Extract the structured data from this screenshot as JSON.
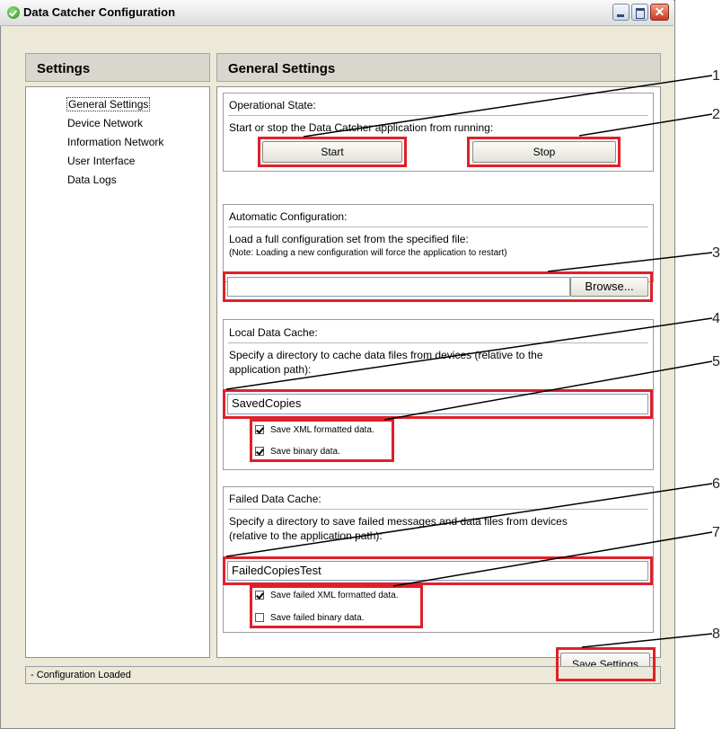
{
  "window": {
    "title": "Data Catcher Configuration"
  },
  "sidebar": {
    "header": "Settings",
    "items": [
      {
        "label": "General Settings",
        "selected": true
      },
      {
        "label": "Device Network"
      },
      {
        "label": "Information Network"
      },
      {
        "label": "User Interface"
      },
      {
        "label": "Data Logs"
      }
    ]
  },
  "main": {
    "header": "General Settings",
    "operational": {
      "title": "Operational State:",
      "desc": "Start or stop the Data Catcher application from running:",
      "start_label": "Start",
      "stop_label": "Stop"
    },
    "auto_config": {
      "title": "Automatic Configuration:",
      "desc": "Load a full configuration set from the specified file:",
      "note": "(Note: Loading a new configuration will force the application to restart)",
      "file_value": "",
      "browse_label": "Browse..."
    },
    "local_cache": {
      "title": "Local Data Cache:",
      "desc_line1": "Specify a directory to cache data files from devices (relative to the",
      "desc_line2": "application path):",
      "dir_value": "SavedCopies",
      "save_xml_label": "Save XML formatted data.",
      "save_xml_checked": true,
      "save_binary_label": "Save binary data.",
      "save_binary_checked": true
    },
    "failed_cache": {
      "title": "Failed Data Cache:",
      "desc_line1": "Specify a directory to save failed messages and data files from devices",
      "desc_line2": "(relative to the application path):",
      "dir_value": "FailedCopiesTest",
      "save_xml_label": "Save failed XML formatted data.",
      "save_xml_checked": true,
      "save_binary_label": "Save failed binary data.",
      "save_binary_checked": false
    },
    "save_settings_label": "Save Settings"
  },
  "status": {
    "text": "- Configuration Loaded"
  },
  "callouts": [
    "1",
    "2",
    "3",
    "4",
    "5",
    "6",
    "7",
    "8"
  ],
  "colors": {
    "highlight": "#e0202a",
    "window_bg": "#ece9d8",
    "header_bg": "#d9d7cd"
  }
}
